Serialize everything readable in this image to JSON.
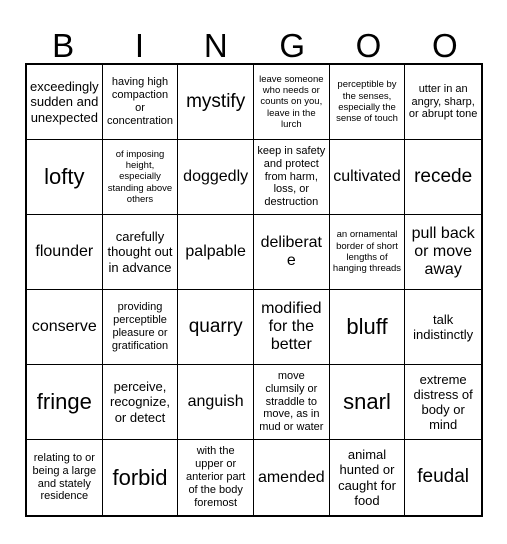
{
  "card": {
    "title": "Bingo Card",
    "headers": [
      "B",
      "I",
      "N",
      "G",
      "O",
      "O"
    ],
    "colors": {
      "background": "#ffffff",
      "text": "#000000",
      "border": "#000000"
    },
    "grid_size": "6x6",
    "cells": [
      {
        "text": "exceedingly sudden and unexpected",
        "size": "sm"
      },
      {
        "text": "having high compaction or concentration",
        "size": "xs"
      },
      {
        "text": "mystify",
        "size": "lg"
      },
      {
        "text": "leave someone who needs or counts on you, leave in the lurch",
        "size": "xxs"
      },
      {
        "text": "perceptible by the senses, especially the sense of touch",
        "size": "xxs"
      },
      {
        "text": "utter in an angry, sharp, or abrupt tone",
        "size": "xs"
      },
      {
        "text": "lofty",
        "size": "xl"
      },
      {
        "text": "of imposing height, especially standing above others",
        "size": "xxs"
      },
      {
        "text": "doggedly",
        "size": "md"
      },
      {
        "text": "keep in safety and protect from harm, loss, or destruction",
        "size": "xs"
      },
      {
        "text": "cultivated",
        "size": "md"
      },
      {
        "text": "recede",
        "size": "lg"
      },
      {
        "text": "flounder",
        "size": "md"
      },
      {
        "text": "carefully thought out in advance",
        "size": "sm"
      },
      {
        "text": "palpable",
        "size": "md"
      },
      {
        "text": "deliberate",
        "size": "md"
      },
      {
        "text": "an ornamental border of short lengths of hanging threads",
        "size": "xxs"
      },
      {
        "text": "pull back or move away",
        "size": "md"
      },
      {
        "text": "conserve",
        "size": "md"
      },
      {
        "text": "providing perceptible pleasure or gratification",
        "size": "xs"
      },
      {
        "text": "quarry",
        "size": "lg"
      },
      {
        "text": "modified for the better",
        "size": "md"
      },
      {
        "text": "bluff",
        "size": "xl"
      },
      {
        "text": "talk indistinctly",
        "size": "sm"
      },
      {
        "text": "fringe",
        "size": "xl"
      },
      {
        "text": "perceive, recognize, or detect",
        "size": "sm"
      },
      {
        "text": "anguish",
        "size": "md"
      },
      {
        "text": "move clumsily or straddle to move, as in mud or water",
        "size": "xs"
      },
      {
        "text": "snarl",
        "size": "xl"
      },
      {
        "text": "extreme distress of body or mind",
        "size": "sm"
      },
      {
        "text": "relating to or being a large and stately residence",
        "size": "xs"
      },
      {
        "text": "forbid",
        "size": "xl"
      },
      {
        "text": "with the upper or anterior part of the body foremost",
        "size": "xs"
      },
      {
        "text": "amended",
        "size": "md"
      },
      {
        "text": "animal hunted or caught for food",
        "size": "sm"
      },
      {
        "text": "feudal",
        "size": "lg"
      }
    ]
  }
}
